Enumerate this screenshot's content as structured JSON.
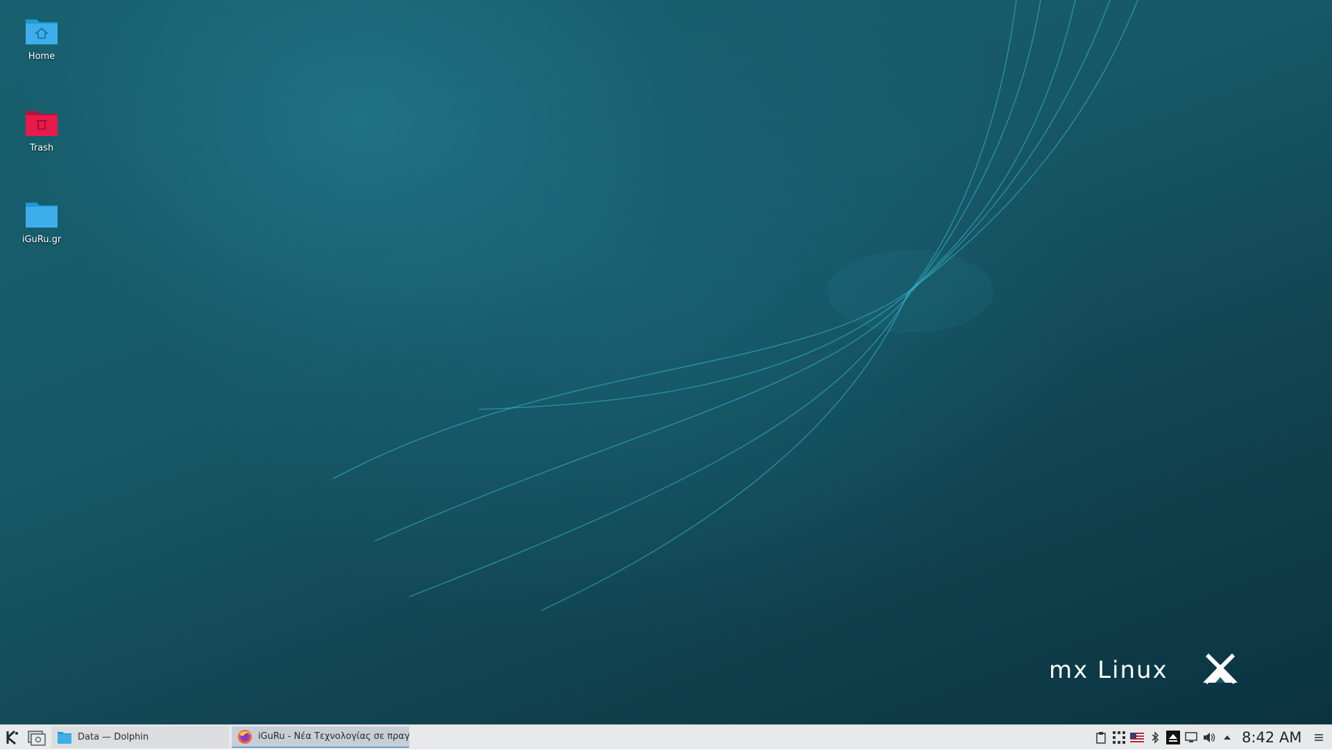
{
  "desktop": {
    "icons": [
      {
        "label": "Home",
        "icon": "home-folder-icon",
        "color": "#3daee9"
      },
      {
        "label": "Trash",
        "icon": "trash-folder-icon",
        "color": "#e8194b"
      },
      {
        "label": "iGuRu.gr",
        "icon": "folder-icon",
        "color": "#3daee9"
      }
    ],
    "wallpaper": {
      "logo_text": "mx Linux",
      "colors": {
        "base": "#175866",
        "light": "#2a8fa6",
        "dark": "#0b3340",
        "line": "#3ec6e0"
      }
    }
  },
  "taskbar": {
    "launcher_icon": "kde-launcher-icon",
    "show_desktop_icon": "show-desktop-icon",
    "tasks": [
      {
        "label": "Data — Dolphin",
        "icon": "dolphin-folder-icon",
        "active": false
      },
      {
        "label": "iGuRu - Νέα Τεχνολογίας σε πραγ...",
        "icon": "firefox-icon",
        "active": true
      }
    ],
    "tray": [
      "clipboard-icon",
      "network-grid-icon",
      "us-flag-icon",
      "bluetooth-icon",
      "eject-icon",
      "display-icon",
      "volume-icon",
      "expand-tray-icon"
    ],
    "clock": "8:42 AM",
    "menu_icon": "hamburger-menu-icon"
  }
}
